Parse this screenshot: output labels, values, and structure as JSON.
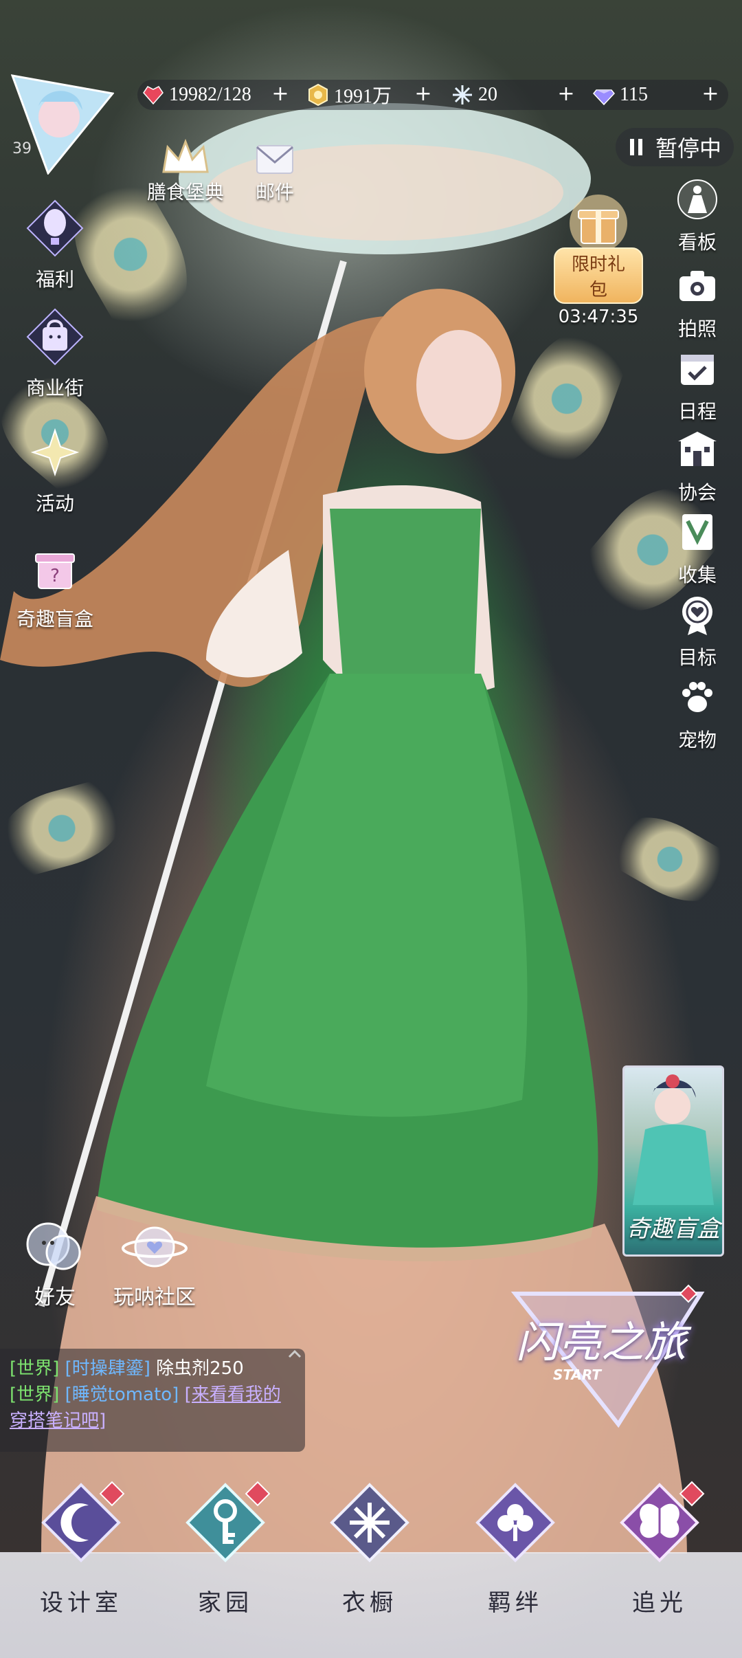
{
  "resources": [
    {
      "name": "stamina",
      "icon": "heart-gem-icon",
      "value": "19982/128",
      "color": "#e8475c"
    },
    {
      "name": "gold",
      "icon": "coin-icon",
      "value": "1991万",
      "color": "#e8b84a"
    },
    {
      "name": "crystal",
      "icon": "snowflake-crystal-icon",
      "value": "20",
      "color": "#cfe6ff"
    },
    {
      "name": "diamond",
      "icon": "diamond-icon",
      "value": "115",
      "color": "#9a8cff"
    }
  ],
  "player": {
    "level": "39"
  },
  "top": {
    "menu_book": "膳食堡典",
    "mail": "邮件",
    "pause": "暂停中",
    "gift_label": "限时礼包",
    "gift_timer": "03:47:35"
  },
  "left_menu": [
    {
      "label": "福利",
      "icon": "hot-air-balloon-icon"
    },
    {
      "label": "商业街",
      "icon": "shopping-bag-icon"
    },
    {
      "label": "活动",
      "icon": "sparkle-star-icon"
    },
    {
      "label": "奇趣盲盒",
      "icon": "mystery-box-icon"
    }
  ],
  "right_menu": [
    {
      "label": "看板",
      "icon": "dress-figure-icon"
    },
    {
      "label": "拍照",
      "icon": "camera-icon"
    },
    {
      "label": "日程",
      "icon": "calendar-check-icon"
    },
    {
      "label": "协会",
      "icon": "guild-building-icon"
    },
    {
      "label": "收集",
      "icon": "collection-book-icon"
    },
    {
      "label": "目标",
      "icon": "heart-medal-icon"
    },
    {
      "label": "宠物",
      "icon": "paw-icon"
    }
  ],
  "social": [
    {
      "label": "好友",
      "icon": "friends-bubble-icon"
    },
    {
      "label": "玩呐社区",
      "icon": "planet-heart-icon"
    }
  ],
  "promo": {
    "blindbox_label": "奇趣盲盒",
    "journey_title": "闪亮之旅",
    "journey_sub": "START"
  },
  "chat": [
    {
      "channel": "[世界]",
      "user": "[时操肆鎏]",
      "text": "除虫剂250"
    },
    {
      "channel": "[世界]",
      "user": "[睡觉tomato]",
      "text": "[来看看我的穿搭笔记吧]"
    }
  ],
  "bottom_nav": [
    {
      "label": "设计室",
      "icon": "moon-crescent-icon"
    },
    {
      "label": "家园",
      "icon": "key-icon"
    },
    {
      "label": "衣橱",
      "icon": "snowflake-icon"
    },
    {
      "label": "羁绊",
      "icon": "clover-icon"
    },
    {
      "label": "追光",
      "icon": "butterfly-icon"
    }
  ]
}
